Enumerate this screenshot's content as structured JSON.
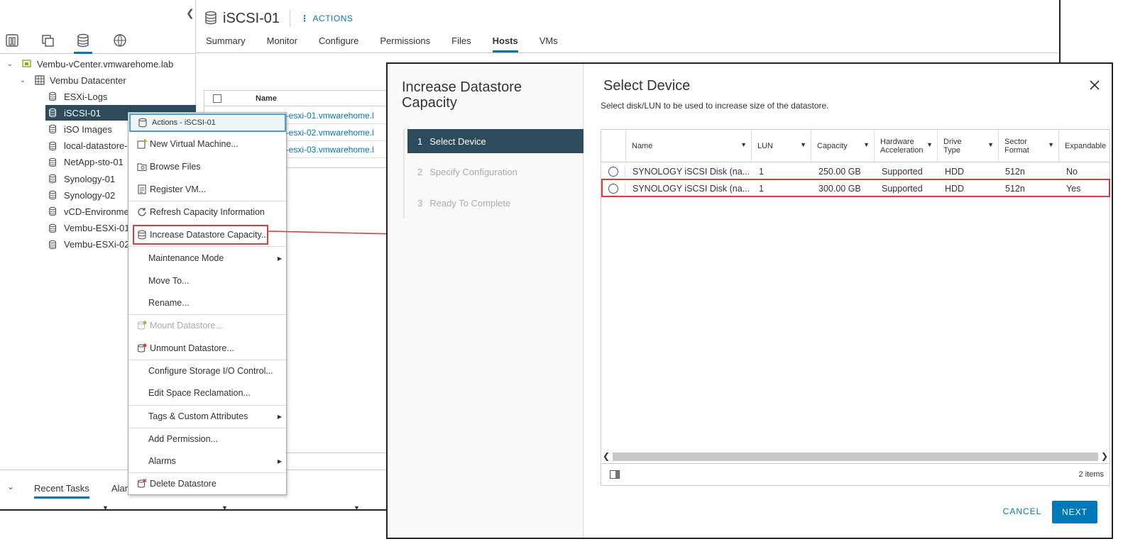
{
  "header": {
    "object_title": "iSCSI-01",
    "actions_label": "ACTIONS",
    "tabs": [
      "Summary",
      "Monitor",
      "Configure",
      "Permissions",
      "Files",
      "Hosts",
      "VMs"
    ],
    "active_tab": "Hosts"
  },
  "tree": {
    "vcenter": "Vembu-vCenter.vmwarehome.lab",
    "datacenter": "Vembu Datacenter",
    "datastores": [
      "ESXi-Logs",
      "iSCSI-01",
      "iSO Images",
      "local-datastore-0",
      "NetApp-sto-01",
      "Synology-01",
      "Synology-02",
      "vCD-Environmen",
      "Vembu-ESXi-01-",
      "Vembu-ESXi-02-"
    ],
    "selected": "iSCSI-01"
  },
  "hosts_grid": {
    "column_name": "Name",
    "hosts": [
      "u-esxi-01.vmwarehome.l",
      "u-esxi-02.vmwarehome.l",
      "u-esxi-03.vmwarehome.l"
    ]
  },
  "bottom": {
    "recent_tasks": "Recent Tasks",
    "alarms_partial": "Alar"
  },
  "context_menu": {
    "header": "Actions - iSCSI-01",
    "items": {
      "new_vm": "New Virtual Machine...",
      "browse_files": "Browse Files",
      "register_vm": "Register VM...",
      "refresh_capacity": "Refresh Capacity Information",
      "increase_capacity": "Increase Datastore Capacity...",
      "maintenance_mode": "Maintenance Mode",
      "move_to": "Move To...",
      "rename": "Rename...",
      "mount": "Mount Datastore...",
      "unmount": "Unmount Datastore...",
      "configure_sioc": "Configure Storage I/O Control...",
      "edit_space": "Edit Space Reclamation...",
      "tags": "Tags & Custom Attributes",
      "add_permission": "Add Permission...",
      "alarms": "Alarms",
      "delete": "Delete Datastore"
    }
  },
  "dialog": {
    "wizard_title": "Increase Datastore Capacity",
    "steps": [
      {
        "num": "1",
        "label": "Select Device"
      },
      {
        "num": "2",
        "label": "Specify Configuration"
      },
      {
        "num": "3",
        "label": "Ready To Complete"
      }
    ],
    "title": "Select Device",
    "subtitle": "Select disk/LUN to be used to increase size of the datastore.",
    "columns": {
      "name": "Name",
      "lun": "LUN",
      "capacity": "Capacity",
      "hw_accel": "Hardware Acceleration",
      "drive_type": "Drive Type",
      "sector_format": "Sector Format",
      "expandable": "Expandable"
    },
    "rows": [
      {
        "name": "SYNOLOGY iSCSI Disk (na...",
        "lun": "1",
        "capacity": "250.00 GB",
        "hw_accel": "Supported",
        "drive_type": "HDD",
        "sector_format": "512n",
        "expandable": "No"
      },
      {
        "name": "SYNOLOGY iSCSI Disk (na...",
        "lun": "1",
        "capacity": "300.00 GB",
        "hw_accel": "Supported",
        "drive_type": "HDD",
        "sector_format": "512n",
        "expandable": "Yes"
      }
    ],
    "items_count": "2 items",
    "cancel": "CANCEL",
    "next": "NEXT"
  },
  "colors": {
    "accent": "#0079b8",
    "selected_bg": "#2e4b5d",
    "highlight": "#e03c3c"
  }
}
